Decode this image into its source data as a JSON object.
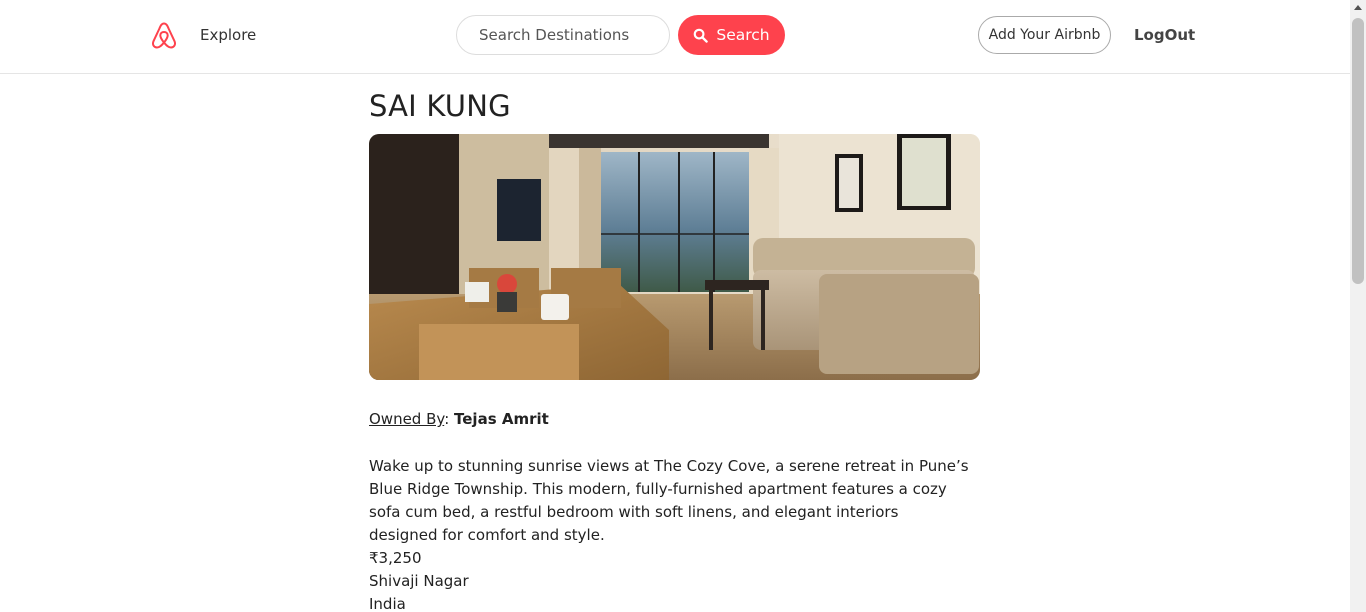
{
  "navbar": {
    "logo_icon": "airbnb-logo-icon",
    "explore_label": "Explore",
    "search_placeholder": "Search Destinations",
    "search_button_label": "Search",
    "search_icon": "search-icon",
    "add_listing_label": "Add Your Airbnb",
    "logout_label": "LogOut"
  },
  "colors": {
    "brand": "#fe424d"
  },
  "listing": {
    "title": "SAI KUNG",
    "owner_label": "Owned By",
    "owner_separator": ": ",
    "owner_name": "Tejas Amrit",
    "description": "Wake up to stunning sunrise views at The Cozy Cove, a serene retreat in Pune’s Blue Ridge Township. This modern, fully-furnished apartment features a cozy sofa cum bed, a restful bedroom with soft linens, and elegant interiors designed for comfort and style.",
    "price": "₹3,250",
    "location": "Shivaji Nagar",
    "country": "India"
  }
}
